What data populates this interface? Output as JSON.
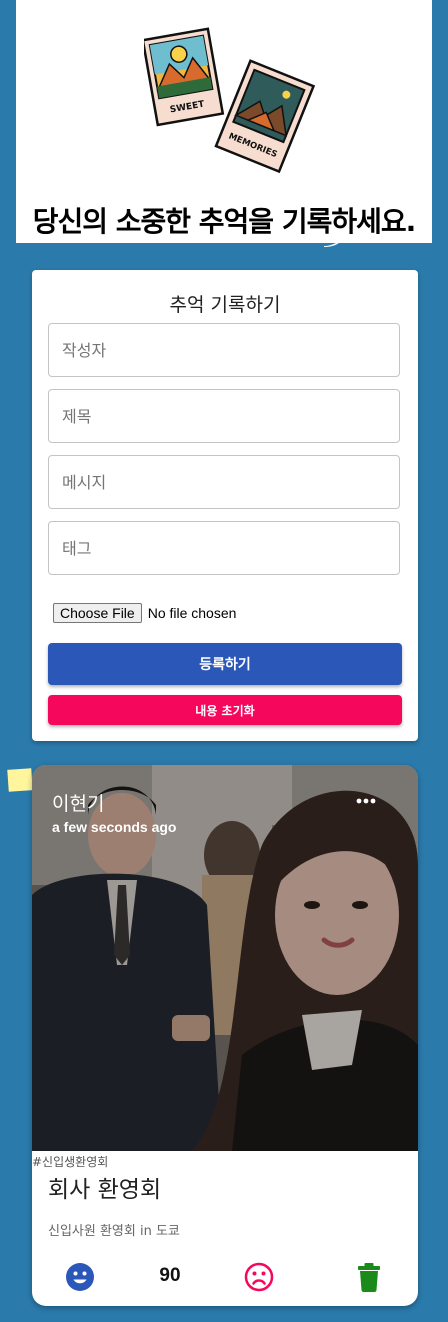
{
  "header": {
    "logo_label": "Sweet Memories logo",
    "logo_text_top": "SWEET",
    "logo_text_bottom": "MEMORIES",
    "tagline": "당신의 소중한 추억을 기록하세요."
  },
  "form": {
    "title": "추억 기록하기",
    "creator_placeholder": "작성자",
    "title_placeholder": "제목",
    "message_placeholder": "메시지",
    "tags_placeholder": "태그",
    "file_button": "Choose File",
    "file_status": "No file chosen",
    "submit_label": "등록하기",
    "reset_label": "내용 초기화",
    "colors": {
      "submit": "#2b58b8",
      "reset": "#f5085c"
    }
  },
  "post": {
    "creator": "이현기",
    "time": "a few seconds ago",
    "more_icon": "more-horiz-icon",
    "tags": "#신입생환영회",
    "title": "회사 환영회",
    "message": "신입사원 환영회 in 도쿄",
    "like_count": "90",
    "like_icon": "smile-icon",
    "dislike_icon": "frown-icon",
    "delete_icon": "trash-icon",
    "colors": {
      "like": "#2b58b8",
      "dislike": "#f5085c",
      "delete": "#1a8a1a"
    }
  }
}
